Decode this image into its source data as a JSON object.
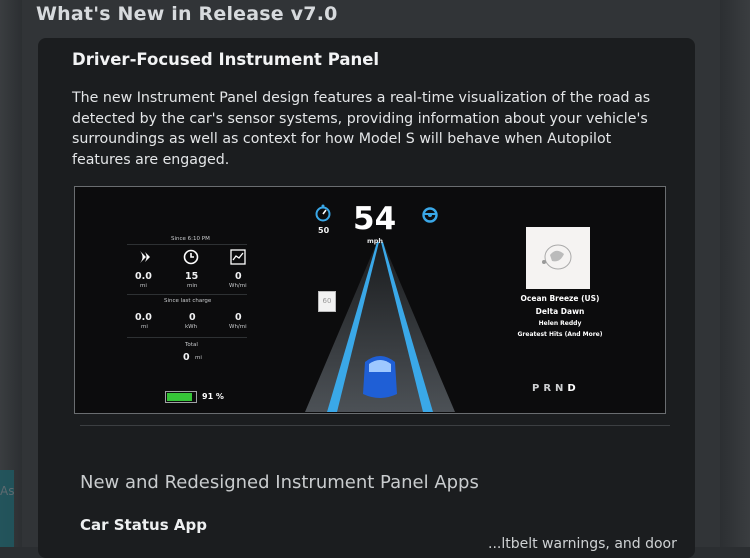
{
  "header": {
    "title": "What's New in Release v7.0"
  },
  "card": {
    "title": "Driver-Focused Instrument Panel",
    "description": "The new Instrument Panel design features a real-time visualization of the road as detected by the car's sensor systems, providing information about your vehicle's surroundings as well as context for how Model S will behave when Autopilot features are engaged."
  },
  "panel": {
    "since_label": "Since 6:10 PM",
    "stats_top": [
      {
        "icon": "driving-icon",
        "value": "0.0",
        "unit": "mi"
      },
      {
        "icon": "clock-icon",
        "value": "15",
        "unit": "min"
      },
      {
        "icon": "energy-graph-icon",
        "value": "0",
        "unit": "Wh/mi"
      }
    ],
    "since_charge_label": "Since last charge",
    "stats_bottom": [
      {
        "value": "0.0",
        "unit": "mi"
      },
      {
        "value": "0",
        "unit": "kWh"
      },
      {
        "value": "0",
        "unit": "Wh/mi"
      }
    ],
    "total_label": "Total",
    "total_value": "0",
    "total_unit": "mi",
    "speed": "54",
    "speed_unit": "mph",
    "speed_limit": "50",
    "sign_text": "60",
    "battery_percent": 0.91,
    "battery_label": "91 %",
    "music": {
      "station": "Ocean Breeze (US)",
      "track": "Delta Dawn",
      "artist": "Helen Reddy",
      "album": "Greatest Hits (And More)"
    },
    "gears": [
      "P",
      "R",
      "N"
    ],
    "active_gear": "D",
    "colors": {
      "lane_blue": "#3aa8e8",
      "car_blue": "#1f5fd6",
      "battery_green": "#36c438"
    }
  },
  "sections": {
    "apps_title": "New and Redesigned Instrument Panel Apps",
    "car_status_title": "Car Status App",
    "cut_text": "...ltbelt warnings, and door"
  },
  "side": {
    "ghost_text": "As"
  }
}
